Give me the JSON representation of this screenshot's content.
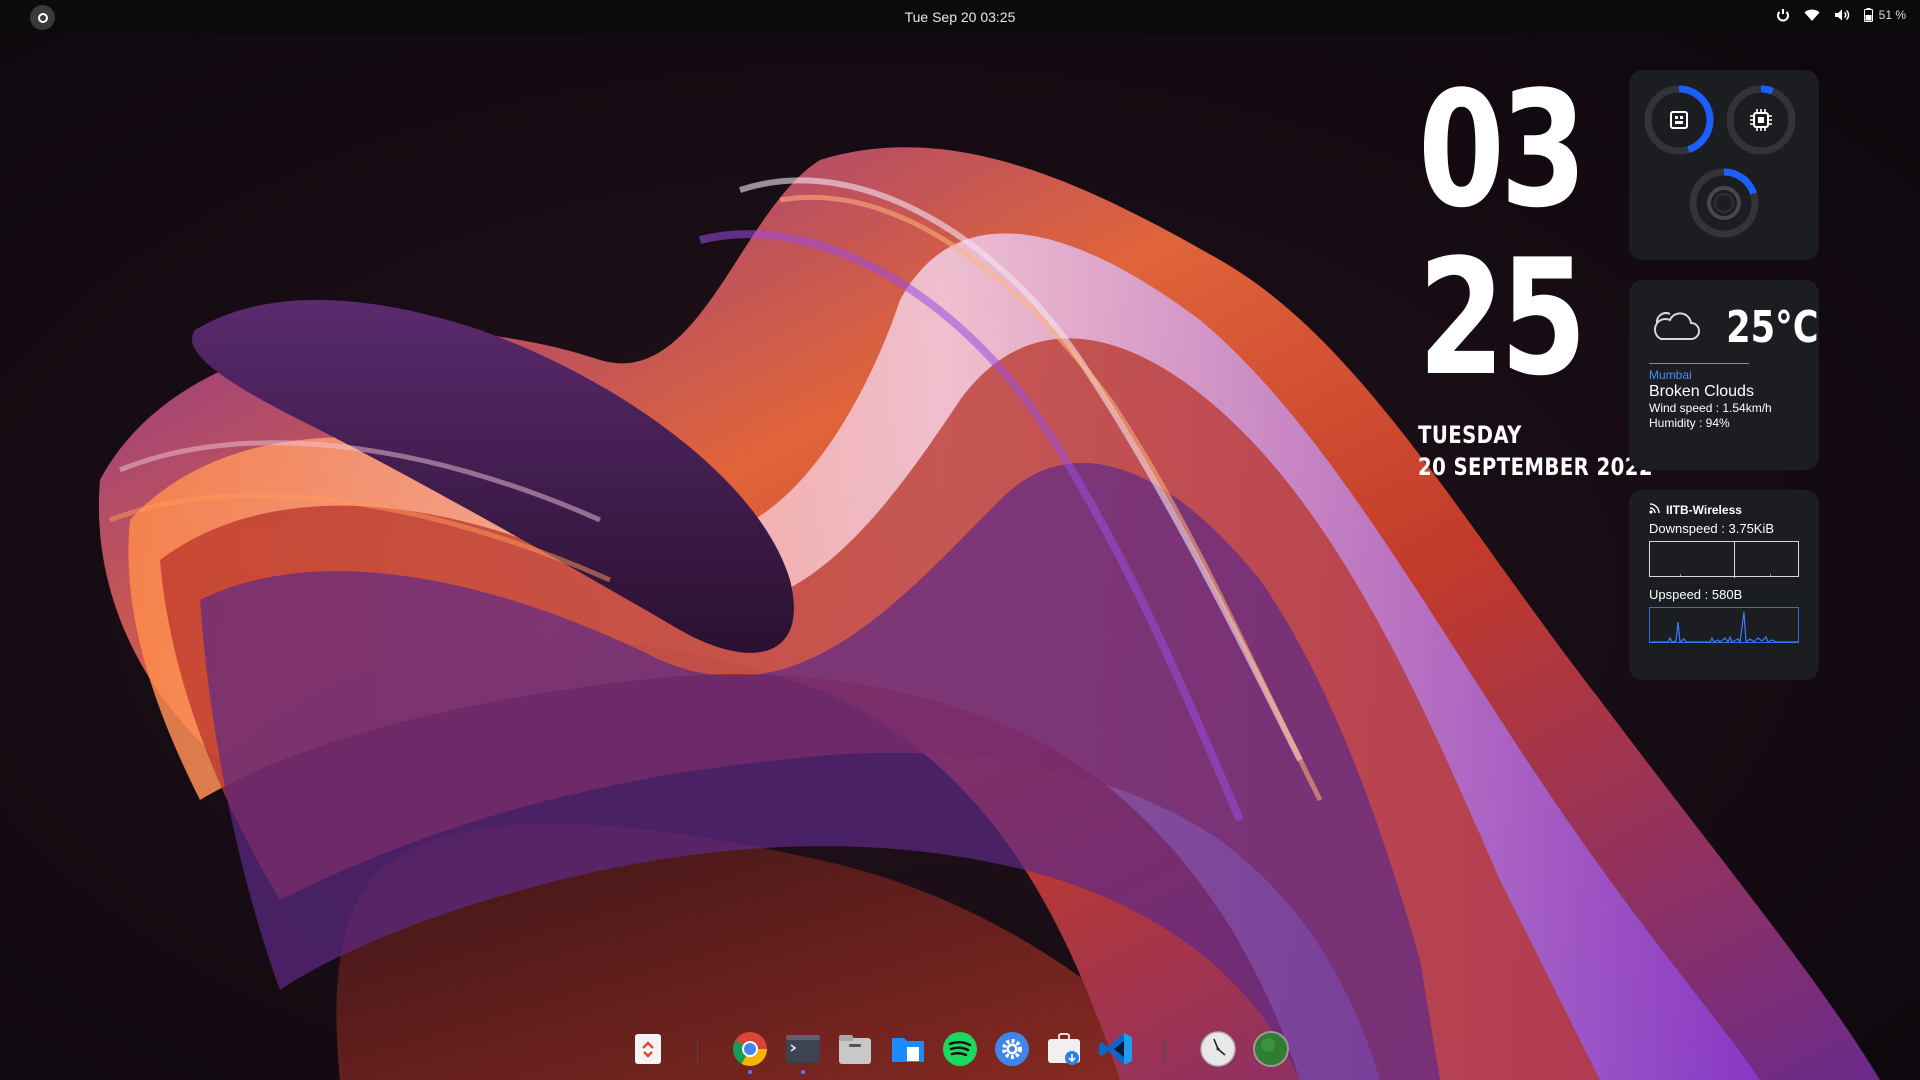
{
  "topbar": {
    "datetime": "Tue Sep 20  03:25",
    "battery_label": "51 %",
    "icons": [
      "activities-icon",
      "power-profile-icon",
      "wifi-icon",
      "volume-icon",
      "battery-icon"
    ]
  },
  "clock": {
    "hours": "03",
    "minutes": "25",
    "day": "TUESDAY",
    "date": "20 SEPTEMBER 2022"
  },
  "system_monitor": {
    "gauges": [
      {
        "name": "memory",
        "icon": "memory-icon",
        "fraction": 0.45
      },
      {
        "name": "cpu",
        "icon": "cpu-icon",
        "fraction": 0.06
      },
      {
        "name": "disk",
        "icon": "disk-icon",
        "fraction": 0.2
      }
    ],
    "accent": "#1a5fff"
  },
  "weather": {
    "icon": "cloud-icon",
    "temperature": "25°C",
    "city": "Mumbai",
    "condition": "Broken Clouds",
    "wind": "Wind speed : 1.54km/h",
    "humidity": "Humidity : 94%"
  },
  "network": {
    "icon": "wifi-signal-icon",
    "ssid": "IITB-Wireless",
    "downspeed": "Downspeed : 3.75KiB",
    "upspeed": "Upspeed : 580B"
  },
  "dock": {
    "items": [
      {
        "name": "trash",
        "icon": "trash-icon"
      },
      {
        "name": "chrome",
        "icon": "chrome-icon",
        "running": true
      },
      {
        "name": "terminal",
        "icon": "terminal-icon",
        "running": true
      },
      {
        "name": "files",
        "icon": "files-icon"
      },
      {
        "name": "file-manager",
        "icon": "folder-icon"
      },
      {
        "name": "spotify",
        "icon": "spotify-icon"
      },
      {
        "name": "settings",
        "icon": "settings-icon"
      },
      {
        "name": "software",
        "icon": "software-store-icon"
      },
      {
        "name": "vscode",
        "icon": "vscode-icon"
      },
      {
        "name": "clocks",
        "icon": "clock-icon"
      },
      {
        "name": "app-green",
        "icon": "green-circle-icon"
      }
    ]
  }
}
